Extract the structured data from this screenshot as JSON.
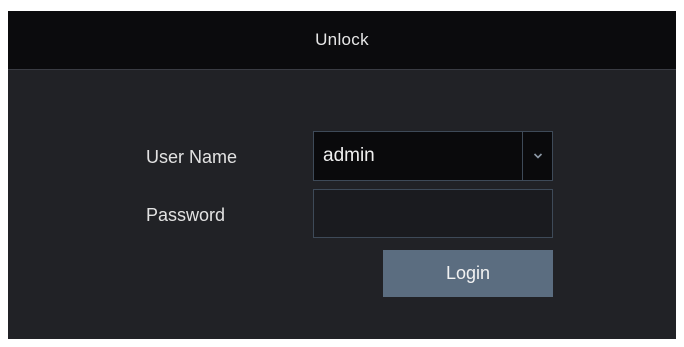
{
  "dialog": {
    "title": "Unlock"
  },
  "form": {
    "username_label": "User Name",
    "username_value": "admin",
    "password_label": "Password",
    "password_value": "",
    "login_label": "Login"
  },
  "icons": {
    "dropdown": "chevron-down-icon"
  },
  "colors": {
    "dialog_background": "#212226",
    "title_bar_background": "#0b0b0d",
    "field_border": "#3e4a58",
    "button_background": "#5b6d80"
  }
}
